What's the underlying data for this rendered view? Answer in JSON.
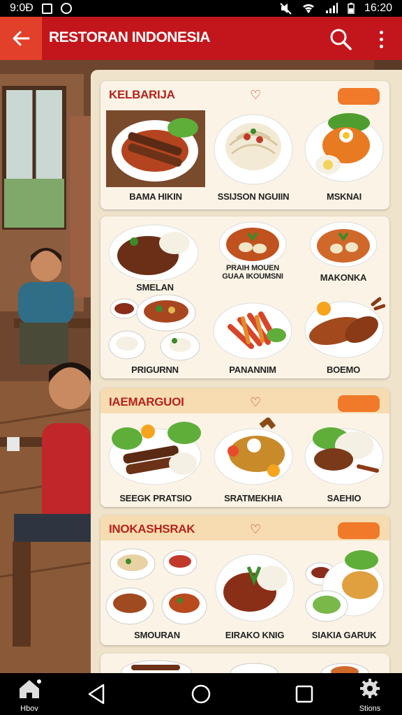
{
  "status_bar": {
    "left_text": "9:0Đ",
    "time": "16:20"
  },
  "app_bar": {
    "title": "RESTORAN INDONESIA",
    "back_icon": "arrow-left-icon",
    "search_icon": "search-icon",
    "more_icon": "more-vert-icon"
  },
  "sections": [
    {
      "title": "KELBARIJA",
      "dishes": [
        "BAMA HIKIN",
        "SSIJSON NGUIIN",
        "MSKNAI"
      ]
    },
    {
      "title": "",
      "dishes": [
        "SMELAN",
        "PRAIH MOUEN GUAA IKOUMSNI",
        "MAKONKA",
        "PRIGURNN",
        "PANANNIM",
        "BOEMO"
      ]
    },
    {
      "title": "IAEMARGUOI",
      "dishes": [
        "SEEGK PRATSIO",
        "SRATMEKHIA",
        "SAEHIO"
      ]
    },
    {
      "title": "INOKASHSRAK",
      "dishes": [
        "SMOURAN",
        "EIRAKO KNIG",
        "SIAKIA GARUK"
      ]
    }
  ],
  "nav_bar": {
    "home_label": "Hbov",
    "settings_label": "Stions"
  },
  "colors": {
    "app_bar": "#c3161c",
    "accent": "#f07a2a",
    "panel": "#efe3cc"
  }
}
